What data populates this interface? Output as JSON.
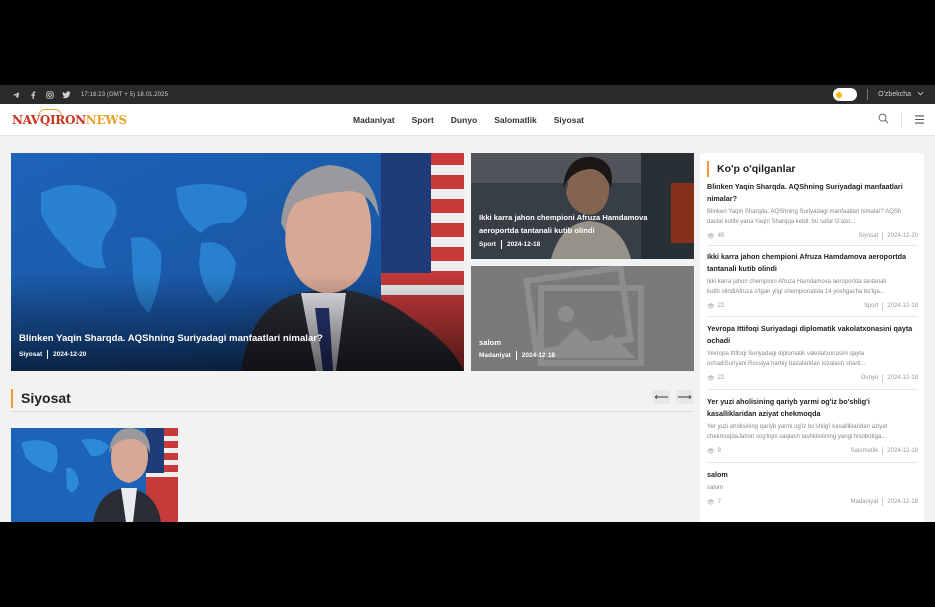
{
  "topbar": {
    "datetime": "17:16:23 (GMT + 5) 18.01.2025",
    "language": "O'zbekcha"
  },
  "header": {
    "logo_part1": "NAVQIRON",
    "logo_part2": "NEWS"
  },
  "nav": [
    "Madaniyat",
    "Sport",
    "Dunyo",
    "Salomatlik",
    "Siyosat"
  ],
  "hero": {
    "title": "Blinken Yaqin Sharqda. AQShning Suriyadagi manfaatlari nimalar?",
    "category": "Siyosat",
    "date": "2024-12-20"
  },
  "side_cards": [
    {
      "title": "Ikki karra jahon chempioni Afruza Hamdamova aeroportda tantanali kutib olindi",
      "category": "Sport",
      "date": "2024-12-18"
    },
    {
      "title": "salom",
      "category": "Madaniyat",
      "date": "2024-12-18"
    }
  ],
  "section": {
    "title": "Siyosat"
  },
  "sidebar": {
    "title": "Ko'p o'qilganlar",
    "items": [
      {
        "title": "Blinken Yaqin Sharqda. AQShning Suriyadagi manfaatlari nimalar?",
        "desc": "Blinken Yaqin Sharqda. AQShning Suriyadagi manfaatlari nimalar? AQSh davlat kotibi yana Yaqin Sharqqa keldi: bu safar G'azo...",
        "views": "45",
        "category": "Siyosat",
        "date": "2024-12-20"
      },
      {
        "title": "Ikki karra jahon chempioni Afruza Hamdamova aeroportda tantanali kutib olindi",
        "desc": "Ikki karra jahon chempioni Afruza Hamdamova aeroportda tantanali",
        "desc2": "kutib olindiAfruza o'tgan yilgi chempionatida 14 yoshgacha bo'lga...",
        "views": "22",
        "category": "Sport",
        "date": "2024-12-18"
      },
      {
        "title": "Yevropa Ittifoqi Suriyadagi diplomatik vakolatxonasini qayta ochadi",
        "desc": "Yevropa Ittifoqi Suriyadagi diplomatik vakolatxonasini qayta",
        "desc2": "ochadiSuriyani Rossiya harbiy bazalaridan tozalash sharti...",
        "views": "22",
        "category": "Dunyo",
        "date": "2024-12-18"
      },
      {
        "title": "Yer yuzi aholisining qariyb yarmi og'iz bo'shlig'i kasalliklaridan aziyat chekmoqda",
        "desc": "Yer yuzi aholisining qariyb yarmi og'iz bo'shlig'i kasalliklaridan aziyat",
        "desc2": "chekmoqdaJahon sog'liqni saqlash tashkilotining yangi hisobotiga...",
        "views": "8",
        "category": "Salomatlik",
        "date": "2024-12-18"
      },
      {
        "title": "salom",
        "desc": "salom",
        "views": "7",
        "category": "Madaniyat",
        "date": "2024-12-18"
      }
    ]
  },
  "colors": {
    "accent": "#f29a2e",
    "topbar": "#2a2a2a",
    "logo_red": "#c7331c",
    "logo_orange": "#e8a12c"
  }
}
